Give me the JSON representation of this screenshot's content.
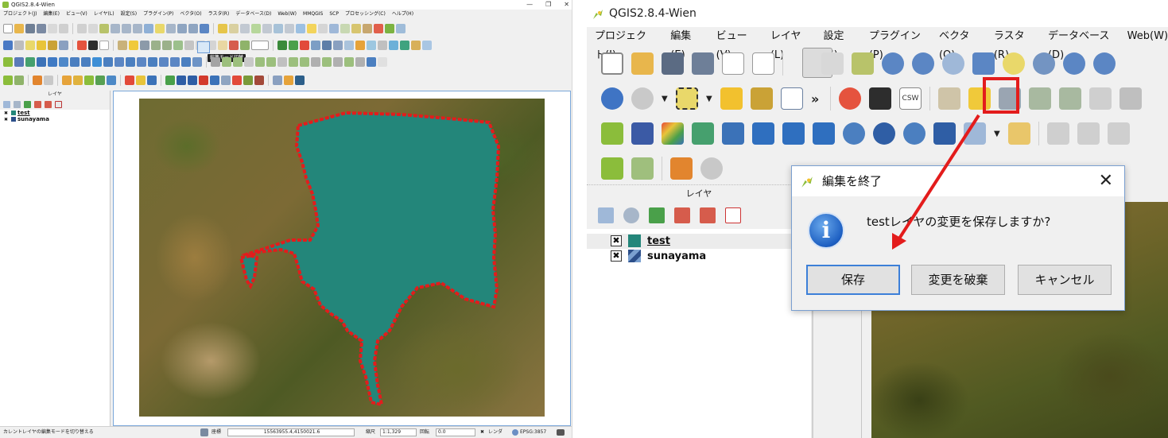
{
  "left": {
    "title": "QGIS2.8.4-Wien",
    "menu": [
      "プロジェクト(J)",
      "編集(E)",
      "ビュー(V)",
      "レイヤ(L)",
      "設定(S)",
      "プラグイン(P)",
      "ベクタ(O)",
      "ラスタ(R)",
      "データベース(D)",
      "Web(W)",
      "MMQGIS",
      "SCP",
      "プロセッシング(C)",
      "ヘルプ(H)"
    ],
    "tooltip": "編集モード切替",
    "layers_header": "レイヤ",
    "layers": [
      {
        "name": "test",
        "active": true,
        "color": "#23867a"
      },
      {
        "name": "sunayama",
        "active": false,
        "color": "#2c4f8a"
      }
    ],
    "status": {
      "message": "カレントレイヤの編集モードを切り替える",
      "coord_label": "座標",
      "coord_value": "15563955.4,4150021.6",
      "scale_label": "縮尺",
      "scale_value": "1:1,329",
      "rotation_label": "回転",
      "rotation_value": "0.0",
      "render_label": "レンダ",
      "crs": "EPSG:3857"
    },
    "scale_box": "0.000"
  },
  "right": {
    "title": "QGIS2.8.4-Wien",
    "menu": [
      "プロジェクト(J)",
      "編集(E)",
      "ビュー(V)",
      "レイヤ(L)",
      "設定(S)",
      "プラグイン(P)",
      "ベクタ(O)",
      "ラスタ(R)",
      "データベース(D)",
      "Web(W)"
    ],
    "csw_label": "CSW",
    "layers_header": "レイヤ",
    "layers": [
      {
        "name": "test",
        "active": true,
        "color": "#23867a"
      },
      {
        "name": "sunayama",
        "active": false,
        "color": "#2c4f8a"
      }
    ],
    "highlight_color": "#e31c1c"
  },
  "dialog": {
    "title": "編集を終了",
    "message": "testレイヤの変更を保存しますか?",
    "buttons": {
      "save": "保存",
      "discard": "変更を破棄",
      "cancel": "キャンセル"
    }
  },
  "colors": {
    "polygon_fill": "#23867a",
    "polygon_outline": "#e31c1c",
    "arrow": "#e31c1c"
  }
}
